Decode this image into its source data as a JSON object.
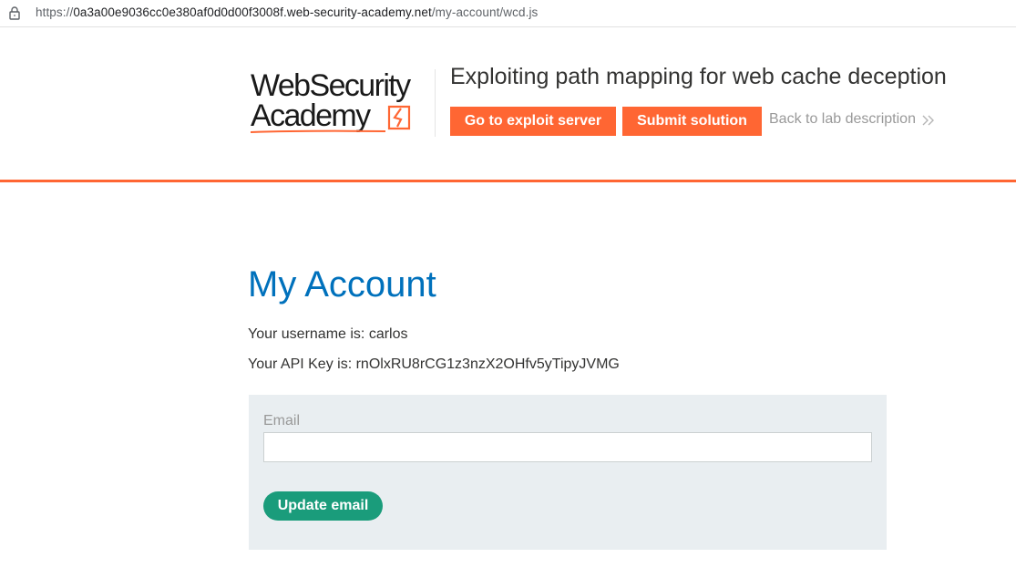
{
  "browser": {
    "url_scheme": "https://",
    "url_host": "0a3a00e9036cc0e380af0d0d00f3008f.web-security-academy.net",
    "url_path": "/my-account/wcd.js",
    "lock_icon": "lock-icon"
  },
  "header": {
    "logo_line1": "WebSecurity",
    "logo_line2": "Academy",
    "lab_title": "Exploiting path mapping for web cache deception",
    "exploit_button": "Go to exploit server",
    "submit_button": "Submit solution",
    "back_link": "Back to lab description",
    "back_icon": "double-chevron-right-icon",
    "accent_color": "#ff6633"
  },
  "main": {
    "title": "My Account",
    "username_line": "Your username is: carlos",
    "apikey_line": "Your API Key is: rnOlxRU8rCG1z3nzX2OHfv5yTipyJVMG",
    "email_form": {
      "label": "Email",
      "value": "",
      "placeholder": "",
      "button": "Update email",
      "button_color": "#1a9c7b"
    },
    "title_color": "#0071bc"
  }
}
